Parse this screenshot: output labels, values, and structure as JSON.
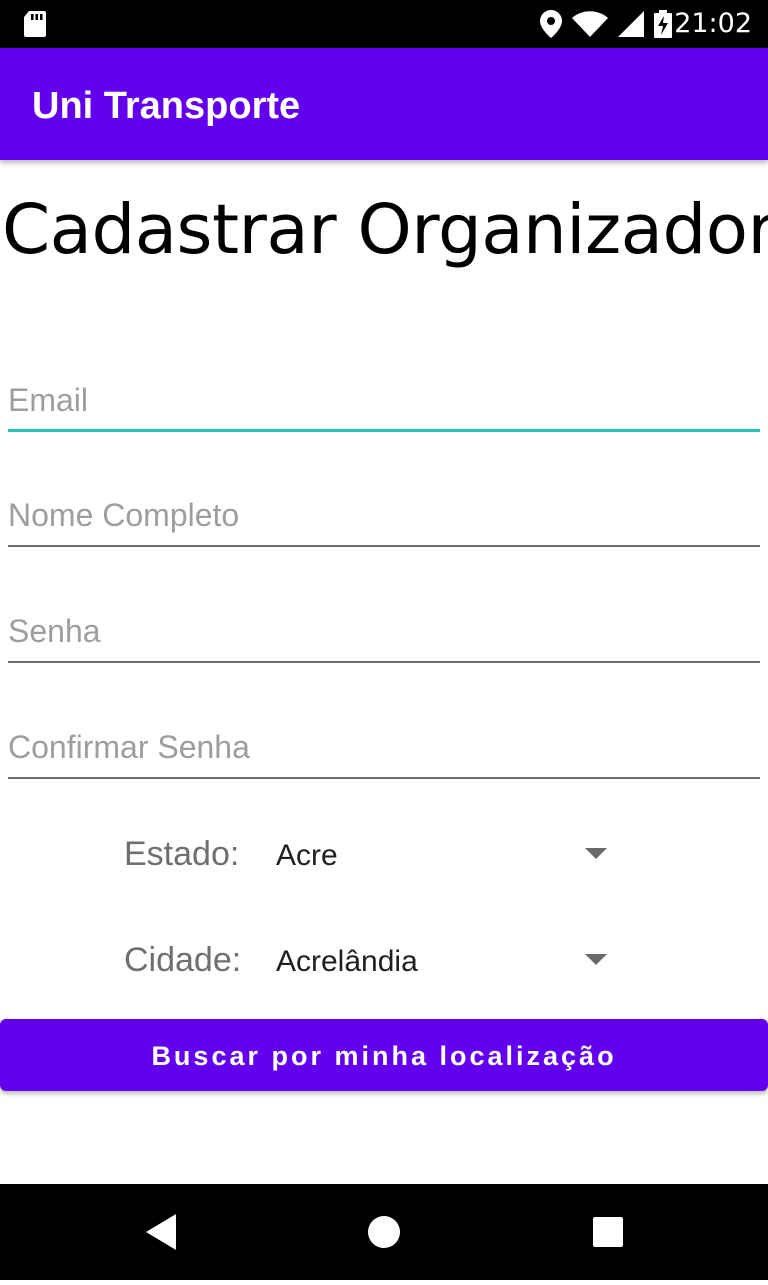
{
  "status_bar": {
    "time": "21:02",
    "icons": [
      "sd-card-icon",
      "location-icon",
      "wifi-icon",
      "signal-icon",
      "battery-charging-icon"
    ]
  },
  "app_bar": {
    "title": "Uni Transporte"
  },
  "page": {
    "title": "Cadastrar Organizador"
  },
  "form": {
    "email": {
      "placeholder": "Email",
      "value": ""
    },
    "nome": {
      "placeholder": "Nome Completo",
      "value": ""
    },
    "senha": {
      "placeholder": "Senha",
      "value": ""
    },
    "confirmar": {
      "placeholder": "Confirmar Senha",
      "value": ""
    },
    "estado": {
      "label": "Estado:",
      "selected": "Acre"
    },
    "cidade": {
      "label": "Cidade:",
      "selected": "Acrelândia"
    },
    "location_button": "Buscar por minha localização"
  },
  "colors": {
    "primary": "#6200ee",
    "accent": "#26c6b6",
    "status_bar": "#000000"
  },
  "nav_bar": {
    "icons": [
      "back-icon",
      "home-icon",
      "recents-icon"
    ]
  }
}
